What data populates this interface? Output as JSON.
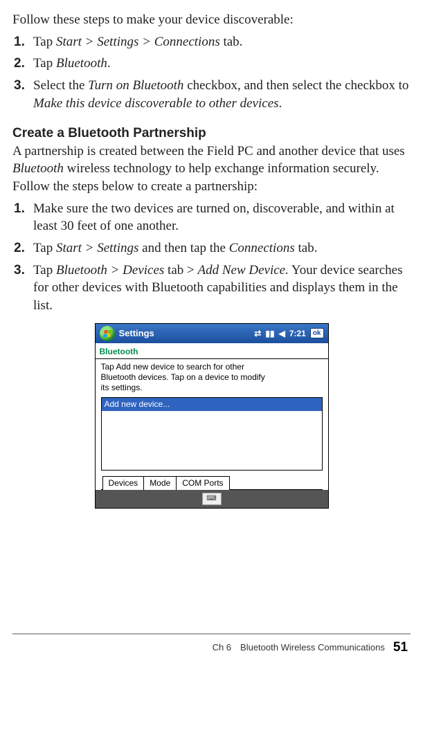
{
  "intro": {
    "text": "Follow these steps to make your device discoverable:"
  },
  "stepsA": {
    "s1": {
      "num": "1.",
      "pre": "Tap ",
      "path": "Start > Settings > Connections",
      "post": " tab."
    },
    "s2": {
      "num": "2.",
      "pre": "Tap ",
      "app": "Bluetooth",
      "post": "."
    },
    "s3": {
      "num": "3.",
      "pre": "Select the ",
      "opt1": "Turn on Bluetooth",
      "mid": " checkbox, and then select the checkbox to ",
      "opt2": "Make this device discoverable to other devices",
      "post": "."
    }
  },
  "heading": {
    "text": "Create a Bluetooth Partnership"
  },
  "paraB": {
    "t1": "A partnership is created between the Field PC and another device that uses ",
    "t2": "Bluetooth",
    "t3": " wireless technology to help exchange information securely. Follow the steps below to create a partnership:"
  },
  "stepsB": {
    "s1": {
      "num": "1.",
      "text": "Make sure the two devices are turned on, discoverable, and within at least 30 feet of one another."
    },
    "s2": {
      "num": "2.",
      "pre": "Tap ",
      "path": "Start > Settings",
      "mid": " and then tap the ",
      "tab": "Connections",
      "post": " tab."
    },
    "s3": {
      "num": "3.",
      "pre": "Tap ",
      "p1": "Bluetooth > Devices",
      "mid1": " tab > ",
      "p2": "Add New Device.",
      "post": " Your device searches for other devices with Bluetooth capabilities and displays them in the list."
    }
  },
  "screenshot": {
    "taskbar_title": "Settings",
    "time": "7:21",
    "ok": "ok",
    "app_title": "Bluetooth",
    "help_l1": "Tap Add new device to search for other",
    "help_l2": "Bluetooth devices. Tap on a device to modify",
    "help_l3": "its settings.",
    "list_item": "Add new device...",
    "tabs": {
      "t1": "Devices",
      "t2": "Mode",
      "t3": "COM Ports"
    }
  },
  "footer": {
    "chapter": "Ch 6 Bluetooth Wireless Communications",
    "page": "51"
  }
}
